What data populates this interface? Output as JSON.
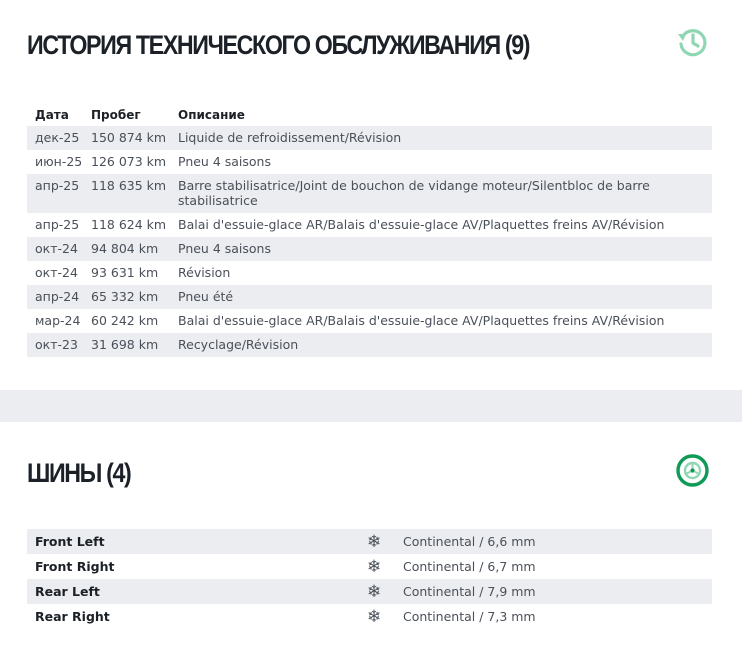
{
  "maintenance": {
    "title": "ИСТОРИЯ ТЕХНИЧЕСКОГО ОБСЛУЖИВАНИЯ (9)",
    "icon": "history-icon",
    "columns": [
      "Дата",
      "Пробег",
      "Описание"
    ],
    "rows": [
      {
        "date": "дек-25",
        "mileage": "150 874 km",
        "description": "Liquide de refroidissement/Révision"
      },
      {
        "date": "июн-25",
        "mileage": "126 073 km",
        "description": "Pneu 4 saisons"
      },
      {
        "date": "апр-25",
        "mileage": "118 635 km",
        "description": "Barre stabilisatrice/Joint de bouchon de vidange moteur/Silentbloc de barre stabilisatrice"
      },
      {
        "date": "апр-25",
        "mileage": "118 624 km",
        "description": "Balai d'essuie-glace AR/Balais d'essuie-glace AV/Plaquettes freins AV/Révision"
      },
      {
        "date": "окт-24",
        "mileage": "94 804 km",
        "description": "Pneu 4 saisons"
      },
      {
        "date": "окт-24",
        "mileage": "93 631 km",
        "description": "Révision"
      },
      {
        "date": "апр-24",
        "mileage": "65 332 km",
        "description": "Pneu été"
      },
      {
        "date": "мар-24",
        "mileage": "60 242 km",
        "description": "Balai d'essuie-glace AR/Balais d'essuie-glace AV/Plaquettes freins AV/Révision"
      },
      {
        "date": "окт-23",
        "mileage": "31 698 km",
        "description": "Recyclage/Révision"
      }
    ]
  },
  "tires": {
    "title": "ШИНЫ (4)",
    "icon": "tire-icon",
    "season_icon": "snowflake-icon",
    "rows": [
      {
        "position": "Front Left",
        "value": "Continental / 6,6 mm"
      },
      {
        "position": "Front Right",
        "value": "Continental / 6,7 mm"
      },
      {
        "position": "Rear Left",
        "value": "Continental / 7,9 mm"
      },
      {
        "position": "Rear Right",
        "value": "Continental / 7,3 mm"
      }
    ]
  },
  "colors": {
    "accent_green": "#0f9a55",
    "accent_green_light": "#8fd6b2",
    "row_alt": "#ebedf0",
    "title_text": "#1c2127"
  }
}
